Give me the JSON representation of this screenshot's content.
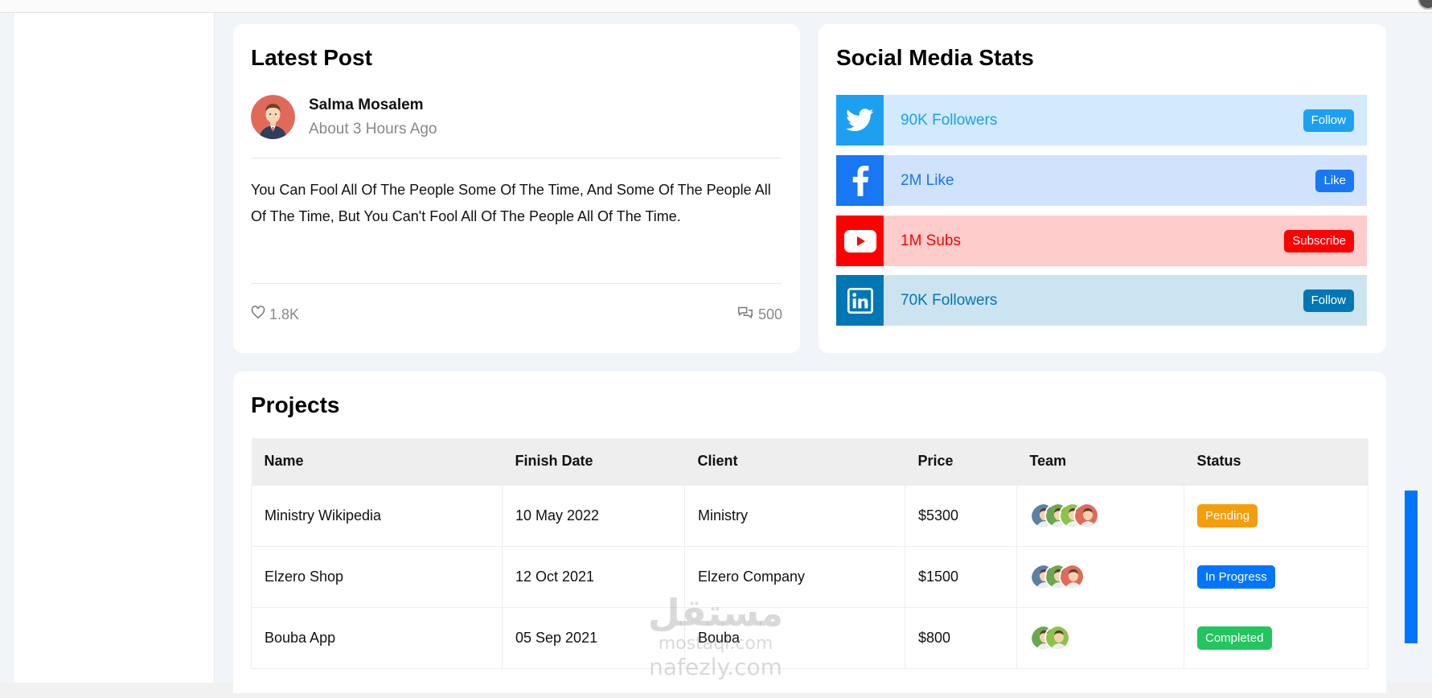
{
  "latest_post": {
    "title": "Latest Post",
    "author": "Salma Mosalem",
    "time": "About 3 Hours Ago",
    "text": "You Can Fool All Of The People Some Of The Time, And Some Of The People All Of The Time, But You Can't Fool All Of The People All Of The Time.",
    "likes": "1.8K",
    "comments": "500"
  },
  "social": {
    "title": "Social Media Stats",
    "rows": [
      {
        "network": "twitter",
        "icon": "twitter-icon",
        "stat": "90K Followers",
        "button": "Follow",
        "color": "#1da0f1",
        "bg": "#d2eafb"
      },
      {
        "network": "facebook",
        "icon": "facebook-icon",
        "stat": "2M Like",
        "button": "Like",
        "color": "#1877f2",
        "bg": "#d0e2fc"
      },
      {
        "network": "youtube",
        "icon": "youtube-icon",
        "stat": "1M Subs",
        "button": "Subscribe",
        "color": "#ff0000",
        "bg": "#ffcccc"
      },
      {
        "network": "linkedin",
        "icon": "linkedin-icon",
        "stat": "70K Followers",
        "button": "Follow",
        "color": "#0077b5",
        "bg": "#cce4f0"
      }
    ]
  },
  "projects": {
    "title": "Projects",
    "headers": [
      "Name",
      "Finish Date",
      "Client",
      "Price",
      "Team",
      "Status"
    ],
    "rows": [
      {
        "name": "Ministry Wikipedia",
        "date": "10 May 2022",
        "client": "Ministry",
        "price": "$5300",
        "team_size": 4,
        "status": "Pending",
        "status_color": "#f59e0b"
      },
      {
        "name": "Elzero Shop",
        "date": "12 Oct 2021",
        "client": "Elzero Company",
        "price": "$1500",
        "team_size": 3,
        "status": "In Progress",
        "status_color": "#0075ff"
      },
      {
        "name": "Bouba App",
        "date": "05 Sep 2021",
        "client": "Bouba",
        "price": "$800",
        "team_size": 2,
        "status": "Completed",
        "status_color": "#22c55e"
      }
    ]
  },
  "watermark": {
    "arabic": "مستقل",
    "line1": "mostaql.com",
    "line2": "nafezly.com"
  },
  "colors": {
    "accent": "#0075ff",
    "page_bg": "#f1f5f9"
  }
}
